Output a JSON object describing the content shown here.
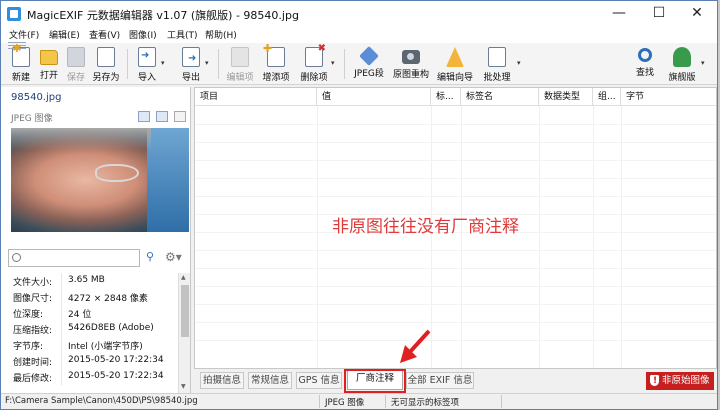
{
  "window": {
    "title": "MagicEXIF 元数据编辑器 v1.07 (旗舰版) - 98540.jpg",
    "minimize": "—",
    "maximize": "☐",
    "close": "✕"
  },
  "menu": [
    "文件(F)",
    "编辑(E)",
    "查看(V)",
    "图像(I)",
    "工具(T)",
    "帮助(H)"
  ],
  "toolbar": {
    "new": "新建",
    "open": "打开",
    "save": "保存",
    "save_as": "另存为",
    "import": "导入",
    "export": "导出",
    "edit_item": "编辑项",
    "add_item": "增添项",
    "delete_item": "删除项",
    "jpeg_segment": "JPEG段",
    "rebuild": "原图重构",
    "edit_wizard": "编辑向导",
    "batch": "批处理",
    "find": "查找",
    "edition": "旗舰版"
  },
  "file_panel": {
    "file_name": "98540.jpg",
    "file_type": "JPEG 图像",
    "properties": [
      {
        "key": "文件大小:",
        "value": "3.65 MB"
      },
      {
        "key": "图像尺寸:",
        "value": "4272 × 2848 像素"
      },
      {
        "key": "位深度:",
        "value": "24 位"
      },
      {
        "key": "压缩指纹:",
        "value": "5426D8EB (Adobe)"
      },
      {
        "key": "字节序:",
        "value": "Intel (小端字节序)"
      },
      {
        "key": "创建时间:",
        "value": "2015-05-20 17:22:34"
      },
      {
        "key": "最后修改:",
        "value": "2015-05-20 17:22:34"
      }
    ]
  },
  "grid": {
    "columns": [
      "项目",
      "值",
      "标...",
      "标签名",
      "数据类型",
      "组...",
      "字节"
    ],
    "annotation": "非原图往往没有厂商注释"
  },
  "tabs": [
    "拍摄信息",
    "常规信息",
    "GPS 信息",
    "厂商注释",
    "全部 EXIF 信息"
  ],
  "badge": "非原始图像",
  "status": {
    "path": "F:\\Camera Sample\\Canon\\450D\\PS\\98540.jpg",
    "type": "JPEG 图像",
    "hidden_tags": "无可显示的标签项"
  },
  "colors": {
    "annotation": "#e03a3a",
    "badge": "#c61f1f",
    "highlight": "#e02020",
    "accent": "#2c6fba"
  }
}
